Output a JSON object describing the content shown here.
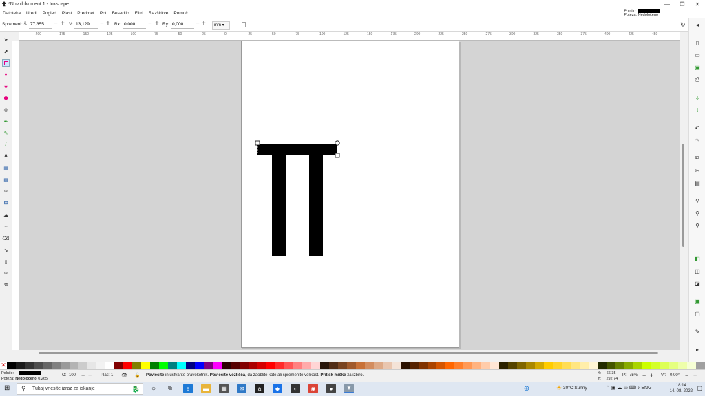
{
  "window": {
    "title": "*Nov dokument 1 - Inkscape",
    "controls": [
      "—",
      "❐",
      "✕"
    ]
  },
  "menu": [
    "Datoteka",
    "Uredi",
    "Pogled",
    "Plast",
    "Predmet",
    "Pot",
    "Besedilo",
    "Filtri",
    "Razširitve",
    "Pomoč"
  ],
  "style_indicator": {
    "fill_label": "Polnilo:",
    "stroke_label": "Poteza:",
    "stroke_value": "Nedoločeno"
  },
  "tool_controls": {
    "width_label": "Spremeni: Š",
    "width_value": "77,355",
    "height_label": "V:",
    "height_value": "13,129",
    "rx_label": "Rx:",
    "rx_value": "0,000",
    "ry_label": "Ry:",
    "ry_value": "0,000",
    "unit": "mm"
  },
  "ruler": {
    "ticks": [
      "-200",
      "-175",
      "-150",
      "-125",
      "-100",
      "-75",
      "-50",
      "-25",
      "0",
      "25",
      "50",
      "75",
      "100",
      "125",
      "150",
      "175",
      "200",
      "225",
      "250",
      "275",
      "300",
      "325",
      "350",
      "375",
      "400",
      "425",
      "450"
    ]
  },
  "colors": {
    "accent": "#e6007e",
    "palette": [
      "#000000",
      "#1a1a1a",
      "#333333",
      "#4d4d4d",
      "#666666",
      "#808080",
      "#999999",
      "#b3b3b3",
      "#cccccc",
      "#e6e6e6",
      "#f2f2f2",
      "#ffffff",
      "#800000",
      "#ff0000",
      "#808000",
      "#ffff00",
      "#008000",
      "#00ff00",
      "#008080",
      "#00ffff",
      "#000080",
      "#0000ff",
      "#800080",
      "#ff00ff",
      "#2b0000",
      "#550000",
      "#800000",
      "#aa0000",
      "#d40000",
      "#ff0000",
      "#ff2a2a",
      "#ff5555",
      "#ff8080",
      "#ffaaaa",
      "#ffd5d5",
      "#28170b",
      "#502d16",
      "#784421",
      "#a05a2c",
      "#c87137",
      "#d38d5f",
      "#deaa87",
      "#e9c6af",
      "#f4e3d7",
      "#2b1100",
      "#552200",
      "#803300",
      "#aa4400",
      "#d45500",
      "#ff6600",
      "#ff7f2a",
      "#ff9955",
      "#ffb380",
      "#ffccaa",
      "#ffe6d5",
      "#2b2200",
      "#554400",
      "#806600",
      "#aa8800",
      "#d4aa00",
      "#ffcc00",
      "#ffd42a",
      "#ffdd55",
      "#ffe680",
      "#ffeeaa",
      "#fff6d5",
      "#222b00",
      "#445500",
      "#668000",
      "#88aa00",
      "#aad400",
      "#ccff00",
      "#d4ff2a",
      "#ddff55",
      "#e5ff80",
      "#eeffaa",
      "#f6ffd5",
      "#a0a0a0"
    ]
  },
  "status": {
    "fill_label": "Polnilo:",
    "stroke_label": "Poteza:",
    "stroke_value": "Nedoločeno",
    "stroke_width": "0,265",
    "opacity_label": "O:",
    "opacity_value": "100",
    "layer": "Plast 1",
    "message_1": "Povlecite",
    "message_2": " in ustvarite pravokotnik. ",
    "message_3": "Povlecite vozlišča",
    "message_4": ", da zaoblite kote ali spremenite velikost. ",
    "message_5": "Pritisk miške",
    "message_6": " za izbiro.",
    "x_label": "X:",
    "x_value": "66,35",
    "y_label": "Y:",
    "y_value": "292,74",
    "zoom_label": "P:",
    "zoom_value": "75%",
    "rotation_label": "Vr:",
    "rotation_value": "0,00°"
  },
  "taskbar": {
    "search_placeholder": "Tukaj vnesite izraz za iskanje",
    "weather": "30°C  Sunny",
    "time": "18:14",
    "date": "14. 08. 2022"
  }
}
